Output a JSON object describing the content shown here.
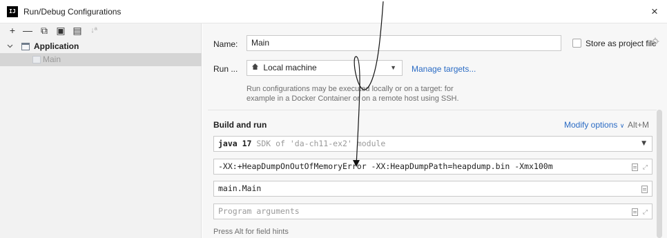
{
  "window": {
    "title": "Run/Debug Configurations",
    "app_icon_text": "IJ",
    "close_glyph": "×"
  },
  "toolbar": {
    "add": "+",
    "remove": "—",
    "copy": "⧉",
    "save": "▣",
    "move": "▤",
    "sort": "↓ª"
  },
  "tree": {
    "group_label": "Application",
    "item_label": "Main"
  },
  "form": {
    "name_label": "Name:",
    "name_value": "Main",
    "store_label": "Store as project file",
    "run_label": "Run ...",
    "run_target": "Local machine",
    "manage_targets": "Manage targets...",
    "run_hint_line1": "Run configurations may be executed locally or on a target: for",
    "run_hint_line2": "example in a Docker Container or on a remote host using SSH.",
    "section_title": "Build and run",
    "modify_options": "Modify options",
    "modify_shortcut": "Alt+M",
    "sdk_java": "java 17",
    "sdk_detail": "SDK of 'da-ch11-ex2' module",
    "vm_options": "-XX:+HeapDumpOnOutOfMemoryError -XX:HeapDumpPath=heapdump.bin -Xmx100m",
    "main_class": "main.Main",
    "program_args_placeholder": "Program arguments",
    "field_hints": "Press Alt for field hints"
  },
  "icons": {
    "home": "home-icon",
    "gear": "gear-icon",
    "chevron": "chevron-down-icon"
  }
}
